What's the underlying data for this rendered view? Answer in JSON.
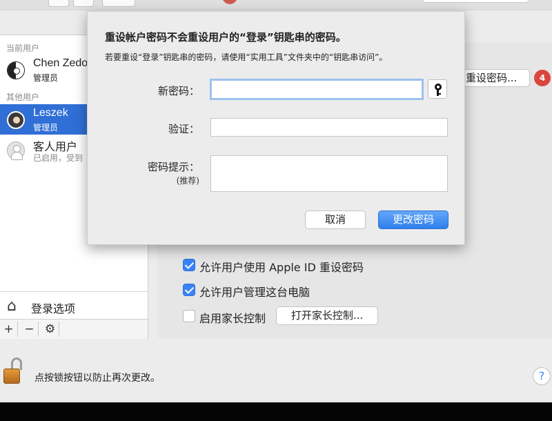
{
  "sidebar": {
    "section_current": "当前用户",
    "section_other": "其他用户",
    "users": [
      {
        "name": "Chen Zedo",
        "role": "管理员"
      },
      {
        "name": "Leszek",
        "role": "管理员"
      },
      {
        "name": "客人用户",
        "role": "已启用，受到"
      }
    ],
    "login_options": "登录选项",
    "tools": [
      "+",
      "−",
      "⚙"
    ]
  },
  "main": {
    "reset_password_button": "重设密码...",
    "badge_count": "4",
    "allow_apple_id": "允许用户使用 Apple ID 重设密码",
    "allow_admin": "允许用户管理这台电脑",
    "enable_parental": "启用家长控制",
    "open_parental_button": "打开家长控制...",
    "checks": {
      "apple_id": true,
      "admin": true,
      "parental": false
    }
  },
  "footer": {
    "lock_text": "点按锁按钮以防止再次更改。",
    "help": "?"
  },
  "dialog": {
    "title": "重设帐户密码不会重设用户的“登录”钥匙串的密码。",
    "subtitle": "若要重设“登录”钥匙串的密码，请使用“实用工具”文件夹中的“钥匙串访问”。",
    "new_password_label": "新密码：",
    "verify_label": "验证：",
    "hint_label": "密码提示：",
    "hint_sublabel": "(推荐)",
    "new_password_value": "",
    "verify_value": "",
    "hint_value": "",
    "cancel_button": "取消",
    "change_button": "更改密码"
  },
  "colors": {
    "accent": "#2f80ec",
    "selected_row": "#2f6fd6",
    "badge": "#d9463c"
  }
}
